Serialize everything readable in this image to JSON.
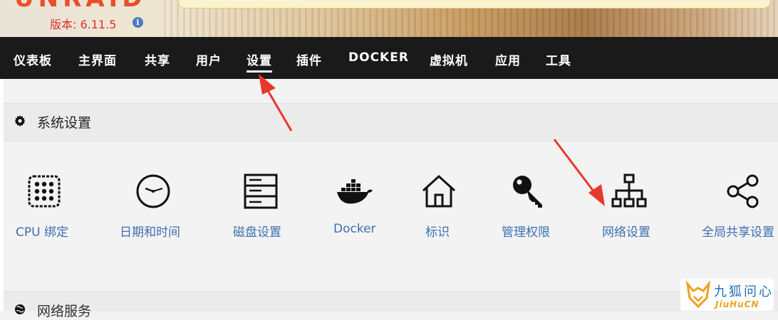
{
  "header": {
    "version": "版本: 6.11.5",
    "info_icon": "i"
  },
  "nav": {
    "items": [
      {
        "label": "仪表板"
      },
      {
        "label": "主界面"
      },
      {
        "label": "共享"
      },
      {
        "label": "用户"
      },
      {
        "label": "设置",
        "active": true
      },
      {
        "label": "插件"
      },
      {
        "label": "DOCKER"
      },
      {
        "label": "虚拟机"
      },
      {
        "label": "应用"
      },
      {
        "label": "工具"
      }
    ]
  },
  "section": {
    "title": "系统设置",
    "icon": "gear-icon",
    "tiles": [
      {
        "label": "CPU 绑定",
        "icon": "cpu-grid-icon"
      },
      {
        "label": "日期和时间",
        "icon": "clock-icon"
      },
      {
        "label": "磁盘设置",
        "icon": "disk-stack-icon"
      },
      {
        "label": "Docker",
        "icon": "docker-whale-icon"
      },
      {
        "label": "标识",
        "icon": "home-icon"
      },
      {
        "label": "管理权限",
        "icon": "key-icon"
      },
      {
        "label": "网络设置",
        "icon": "network-icon"
      },
      {
        "label": "全局共享设置",
        "icon": "share-icon"
      }
    ]
  },
  "section2": {
    "title": "网络服务",
    "icon": "globe-icon"
  },
  "watermark": {
    "cn": "九狐问心",
    "en": "JiuHuCN"
  },
  "colors": {
    "nav_bg": "#1a1a1a",
    "link": "#3d6fb0",
    "version": "#e0312a",
    "arrow": "#e8382c"
  }
}
